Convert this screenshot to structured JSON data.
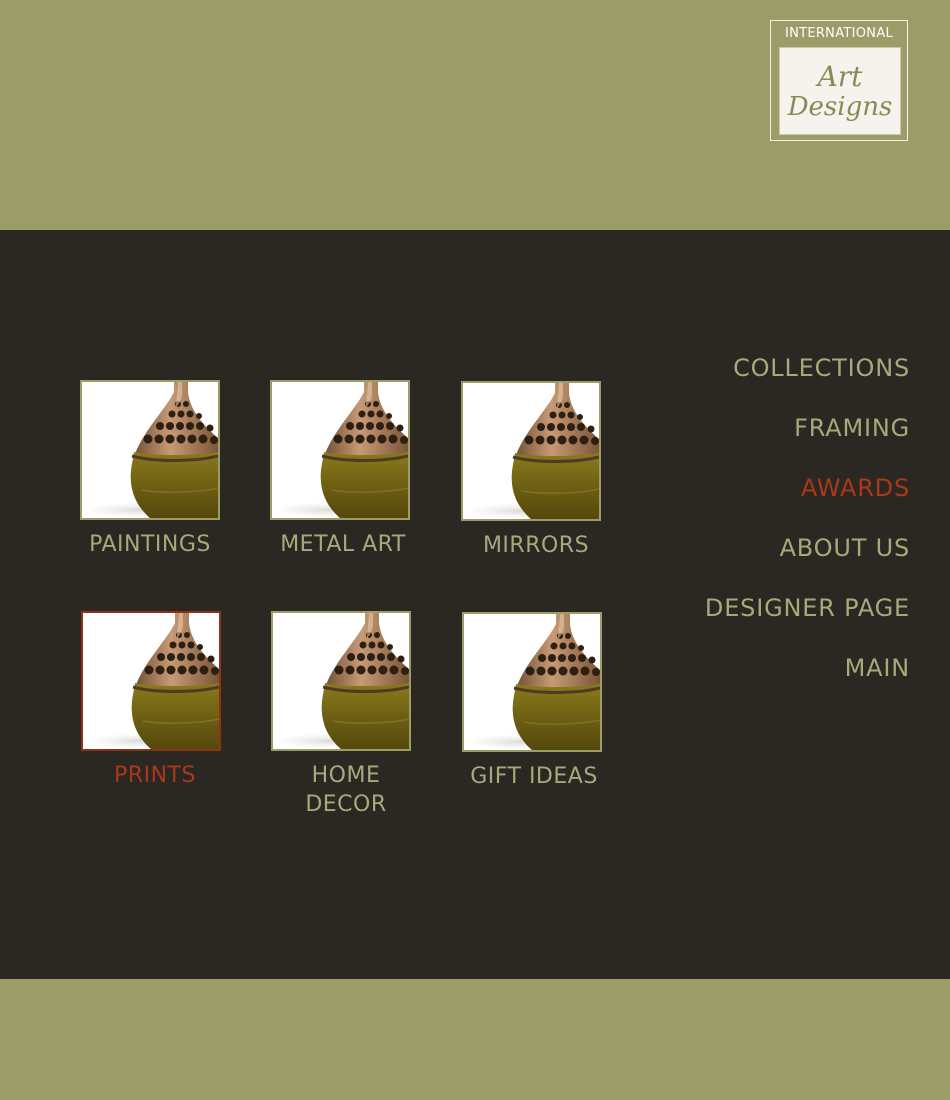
{
  "logo": {
    "top_text": "INTERNATIONAL",
    "line1": "Art",
    "line2": "Designs"
  },
  "colors": {
    "olive_background": "#9c9c68",
    "main_panel": "#2b2722",
    "label_text": "#a9a87a",
    "active_text": "#a9391a"
  },
  "categories": [
    {
      "label": "PAINTINGS",
      "active": false
    },
    {
      "label": "METAL ART",
      "active": false
    },
    {
      "label": "MIRRORS",
      "active": false
    },
    {
      "label": "PRINTS",
      "active": true
    },
    {
      "label": "HOME DECOR",
      "active": false
    },
    {
      "label": "GIFT IDEAS",
      "active": false
    }
  ],
  "thumbnail_icon": "vase-image",
  "nav": [
    {
      "label": "COLLECTIONS",
      "active": false
    },
    {
      "label": "FRAMING",
      "active": false
    },
    {
      "label": "AWARDS",
      "active": true
    },
    {
      "label": "ABOUT US",
      "active": false
    },
    {
      "label": "DESIGNER PAGE",
      "active": false
    },
    {
      "label": "MAIN",
      "active": false
    }
  ]
}
